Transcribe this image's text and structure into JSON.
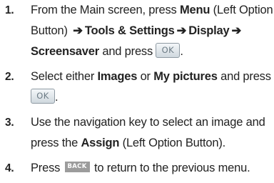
{
  "steps": [
    {
      "number": "1.",
      "line1_text1": "From the Main screen, press ",
      "line1_bold1": "Menu",
      "line2_text1": "Button) ",
      "line2_bold1": "Tools & Settings",
      "line2_bold2": "Display",
      "line3_bold1": "Screensaver",
      "line3_text1": " and press ",
      "line1_text2": " (Left Option"
    },
    {
      "number": "2.",
      "line1_text1": "Select either ",
      "line1_bold1": "Images",
      "line1_text2": " or ",
      "line1_bold2": "My pictures",
      "line1_text3": " and press"
    },
    {
      "number": "3.",
      "line1_text1": "Use the navigation key to select an image and",
      "line2_text1": "press the ",
      "line2_bold1": "Assign",
      "line2_text2": " (Left Option Button)."
    },
    {
      "number": "4.",
      "line1_text1": "Press ",
      "line1_text2": " to return to the previous menu."
    }
  ],
  "arrow_glyph": "➔",
  "keys": {
    "ok_label": "OK",
    "back_label": "BACK"
  },
  "punctuation": {
    "period": "."
  }
}
